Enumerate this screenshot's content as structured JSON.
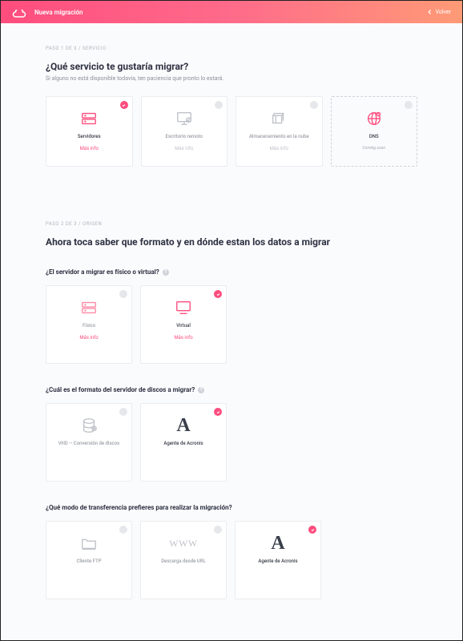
{
  "header": {
    "title": "Nueva migración",
    "back": "Volver"
  },
  "step1": {
    "breadcrumb": "PASO 1 DE 3  /  SERVICIO",
    "title": "¿Qué servicio te gustaría migrar?",
    "subtitle": "Si alguno no está disponible todavía, ten paciencia que pronto lo estará.",
    "cards": [
      {
        "title": "Servidores",
        "more": "Más info"
      },
      {
        "title": "Escritorio remoto",
        "more": "Más info"
      },
      {
        "title": "Almacenamiento en la nube",
        "more": "Más info"
      },
      {
        "title": "DNS",
        "sub": "Coming soon"
      }
    ]
  },
  "step2": {
    "breadcrumb": "PASO 2 DE 3  /  ORIGEN",
    "title": "Ahora toca saber que formato y en dónde estan los datos a migrar",
    "q1": "¿El servidor a migrar es físico o virtual?",
    "q1_cards": [
      {
        "title": "Físico",
        "more": "Más info"
      },
      {
        "title": "Virtual",
        "more": "Más info"
      }
    ],
    "q2": "¿Cuál es el formato del servidor de discos a migrar?",
    "q2_cards": [
      {
        "title": "VHD – Conversión de discos"
      },
      {
        "title": "Agente de Acronis"
      }
    ],
    "q3": "¿Qué modo de transferencia prefieres para realizar la migración?",
    "q3_cards": [
      {
        "title": "Cliente FTP"
      },
      {
        "title": "Descarga desde URL"
      },
      {
        "title": "Agente de Acronis"
      }
    ]
  }
}
